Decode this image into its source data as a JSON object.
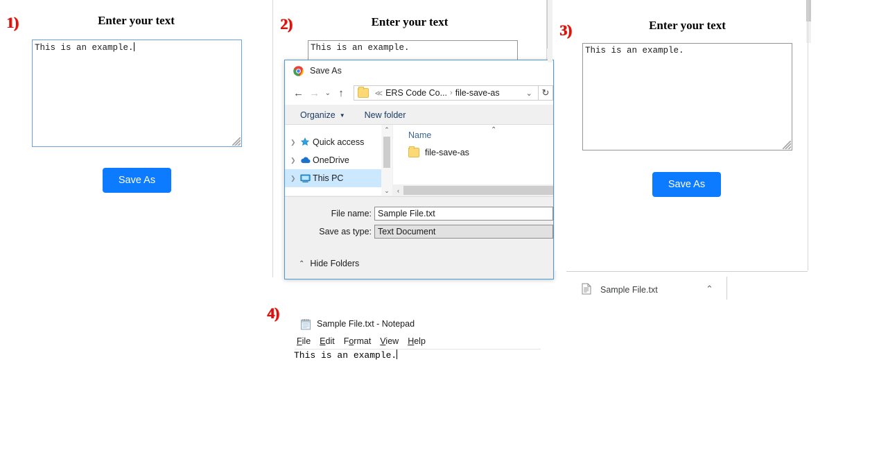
{
  "colors": {
    "marker_red": "#d51313",
    "primary_blue": "#0d7bff",
    "dialog_border_blue": "#4a9ad4",
    "selection_blue": "#cce8ff",
    "focus_border": "#6ca0dd"
  },
  "steps": [
    {
      "label": "1)"
    },
    {
      "label": "2)"
    },
    {
      "label": "3)"
    },
    {
      "label": "4)"
    }
  ],
  "panel1": {
    "heading": "Enter your text",
    "textarea_value": "This is an example.",
    "save_button_label": "Save As"
  },
  "panel2": {
    "heading": "Enter your text",
    "textarea_value": "This is an example."
  },
  "panel3": {
    "heading": "Enter your text",
    "textarea_value": "This is an example.",
    "save_button_label": "Save As",
    "download_shelf": {
      "file_name": "Sample File.txt",
      "chevron": "⌃"
    }
  },
  "save_dialog": {
    "title": "Save As",
    "nav": {
      "back": "←",
      "forward": "→",
      "recent_chevron": "⌄",
      "up": "↑",
      "dropdown_chevron": "⌄",
      "refresh": "↻"
    },
    "address": {
      "crumb_prefix": "≪",
      "crumb1": "ERS Code Co...",
      "separator": "›",
      "crumb2": "file-save-as"
    },
    "commandbar": {
      "organize": "Organize",
      "organize_caret": "▼",
      "new_folder": "New folder"
    },
    "nav_tree": [
      {
        "label": "Quick access",
        "icon": "star-icon",
        "selected": false
      },
      {
        "label": "OneDrive",
        "icon": "cloud-icon",
        "selected": false
      },
      {
        "label": "This PC",
        "icon": "monitor-icon",
        "selected": true
      }
    ],
    "filelist": {
      "column_header": "Name",
      "sort_indicator": "⌃",
      "rows": [
        {
          "name": "file-save-as",
          "icon": "folder-icon"
        }
      ]
    },
    "fields": {
      "file_name_label": "File name:",
      "file_name_value": "Sample File.txt",
      "save_as_type_label": "Save as type:",
      "save_as_type_value": "Text Document"
    },
    "hide_folders": {
      "chevron": "⌃",
      "label": "Hide Folders"
    },
    "scroll_arrows": {
      "up": "⌃",
      "down": "⌄",
      "left": "‹"
    }
  },
  "notepad": {
    "title": "Sample File.txt - Notepad",
    "menu": [
      {
        "accel": "F",
        "rest": "ile"
      },
      {
        "accel": "E",
        "rest": "dit"
      },
      {
        "pre": "F",
        "accel": "o",
        "rest": "rmat"
      },
      {
        "accel": "V",
        "rest": "iew"
      },
      {
        "accel": "H",
        "rest": "elp"
      }
    ],
    "content": "This is an example."
  }
}
